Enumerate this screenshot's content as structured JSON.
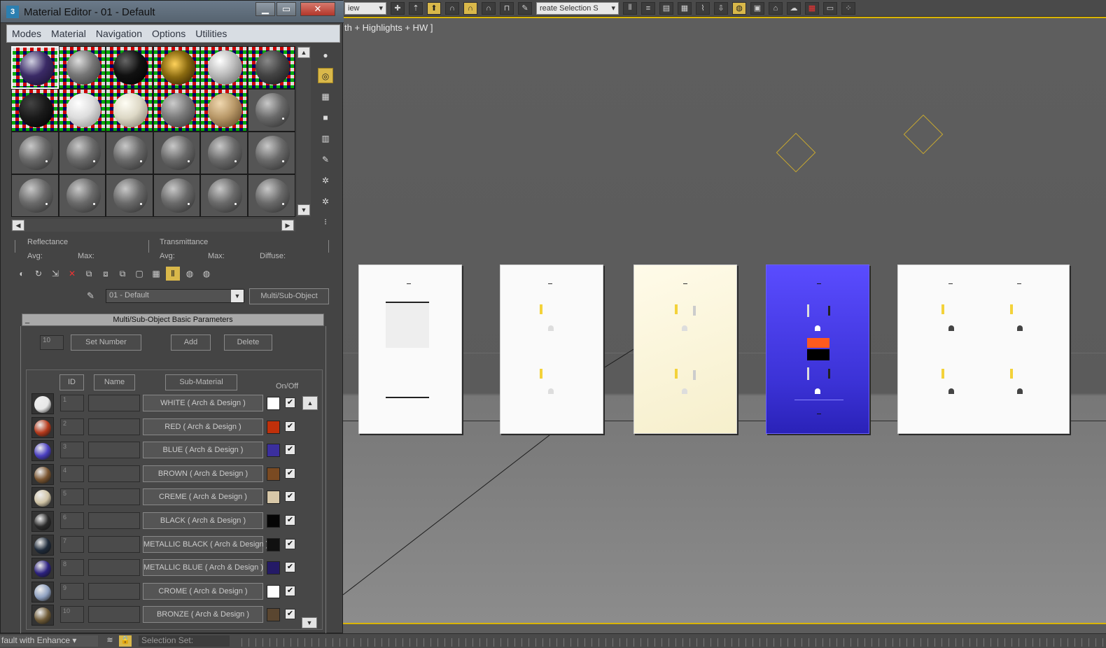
{
  "toolbar": {
    "view_dropdown": "iew",
    "selection_set": "reate Selection S"
  },
  "viewport": {
    "label": "th + Highlights + HW ]"
  },
  "editor": {
    "title": "Material Editor - 01 - Default",
    "app_icon": "3ds-max-icon",
    "menu": [
      "Modes",
      "Material",
      "Navigation",
      "Options",
      "Utilities"
    ],
    "reflectance": {
      "heading": "Reflectance",
      "avg": "Avg:",
      "max": "Max:"
    },
    "transmittance": {
      "heading": "Transmittance",
      "avg": "Avg:",
      "max": "Max:",
      "diffuse": "Diffuse:"
    },
    "material_name": "01 - Default",
    "material_type": "Multi/Sub-Object",
    "rollout_title": "Multi/Sub-Object Basic Parameters",
    "rollout_toggle": "_",
    "count": "10",
    "set_number": "Set Number",
    "add": "Add",
    "delete": "Delete",
    "col_id": "ID",
    "col_name": "Name",
    "col_sub": "Sub-Material",
    "col_onoff": "On/Off",
    "rows": [
      {
        "id": "1",
        "sub": "WHITE  ( Arch & Design )",
        "color": "#ffffff",
        "ball": "#e8e8e8"
      },
      {
        "id": "2",
        "sub": "RED  ( Arch & Design )",
        "color": "#c0300a",
        "ball": "#b63a1c"
      },
      {
        "id": "3",
        "sub": "BLUE  ( Arch & Design )",
        "color": "#3b2f9e",
        "ball": "#4a3fc0"
      },
      {
        "id": "4",
        "sub": "BROWN  ( Arch & Design )",
        "color": "#7a4a22",
        "ball": "#7a5530"
      },
      {
        "id": "5",
        "sub": "CREME  ( Arch & Design )",
        "color": "#d8c8a8",
        "ball": "#d0c4a6"
      },
      {
        "id": "6",
        "sub": "BLACK  ( Arch & Design )",
        "color": "#050505",
        "ball": "#2a2a2a"
      },
      {
        "id": "7",
        "sub": "METALLIC BLACK  ( Arch & Design )",
        "color": "#111111",
        "ball": "#1e2a3a"
      },
      {
        "id": "8",
        "sub": "METALLIC BLUE  ( Arch & Design )",
        "color": "#241a66",
        "ball": "#2c2180"
      },
      {
        "id": "9",
        "sub": "CROME  ( Arch & Design )",
        "color": "#ffffff",
        "ball": "#8ea0c0"
      },
      {
        "id": "10",
        "sub": "BRONZE  ( Arch & Design )",
        "color": "#5a4630",
        "ball": "#6e5a36"
      }
    ]
  },
  "status": {
    "preset": "fault with Enhance",
    "selection": "Selection Set:"
  }
}
